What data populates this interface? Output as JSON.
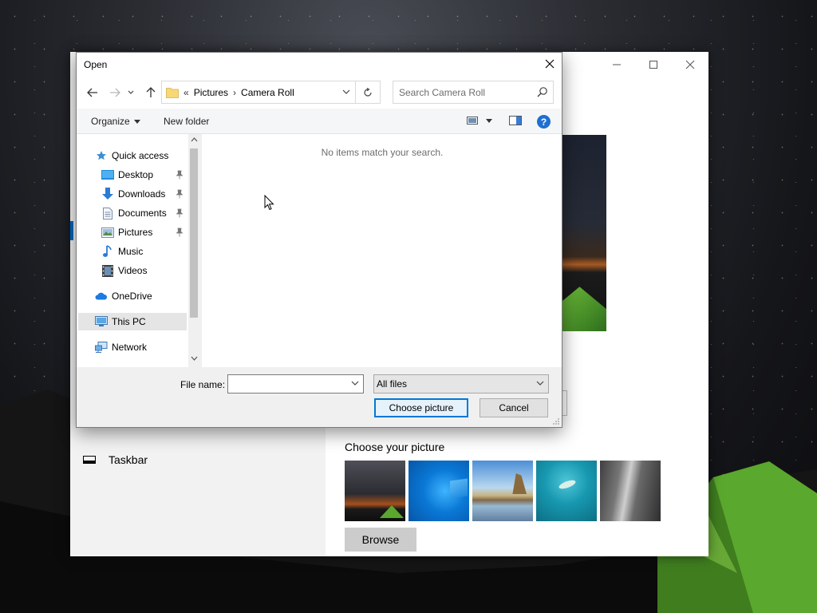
{
  "dialog": {
    "title": "Open",
    "address": {
      "overflow": "«",
      "segments": [
        "Pictures",
        "Camera Roll"
      ],
      "separator": "›"
    },
    "search": {
      "placeholder": "Search Camera Roll"
    },
    "toolbar": {
      "organize_label": "Organize",
      "new_folder_label": "New folder",
      "help_label": "?"
    },
    "nav_pane": {
      "items": [
        {
          "label": "Quick access",
          "icon": "star-icon",
          "pinned": false
        },
        {
          "label": "Desktop",
          "icon": "desktop-folder-icon",
          "pinned": true
        },
        {
          "label": "Downloads",
          "icon": "download-arrow-icon",
          "pinned": true
        },
        {
          "label": "Documents",
          "icon": "document-icon",
          "pinned": true
        },
        {
          "label": "Pictures",
          "icon": "pictures-icon",
          "pinned": true
        },
        {
          "label": "Music",
          "icon": "music-note-icon",
          "pinned": false
        },
        {
          "label": "Videos",
          "icon": "film-icon",
          "pinned": false
        },
        {
          "label": "OneDrive",
          "icon": "cloud-icon",
          "pinned": false
        },
        {
          "label": "This PC",
          "icon": "computer-icon",
          "pinned": false,
          "selected": true
        },
        {
          "label": "Network",
          "icon": "network-icon",
          "pinned": false
        }
      ]
    },
    "content": {
      "empty_message": "No items match your search."
    },
    "file_name": {
      "label": "File name:",
      "value": ""
    },
    "file_type": {
      "selected": "All files"
    },
    "buttons": {
      "open_label": "Choose picture",
      "cancel_label": "Cancel"
    }
  },
  "settings": {
    "taskbar_label": "Taskbar",
    "choose_picture_title": "Choose your picture",
    "browse_label": "Browse"
  },
  "colors": {
    "accent": "#0078d7",
    "help": "#1e6fd0",
    "folder": "#f8d775"
  }
}
